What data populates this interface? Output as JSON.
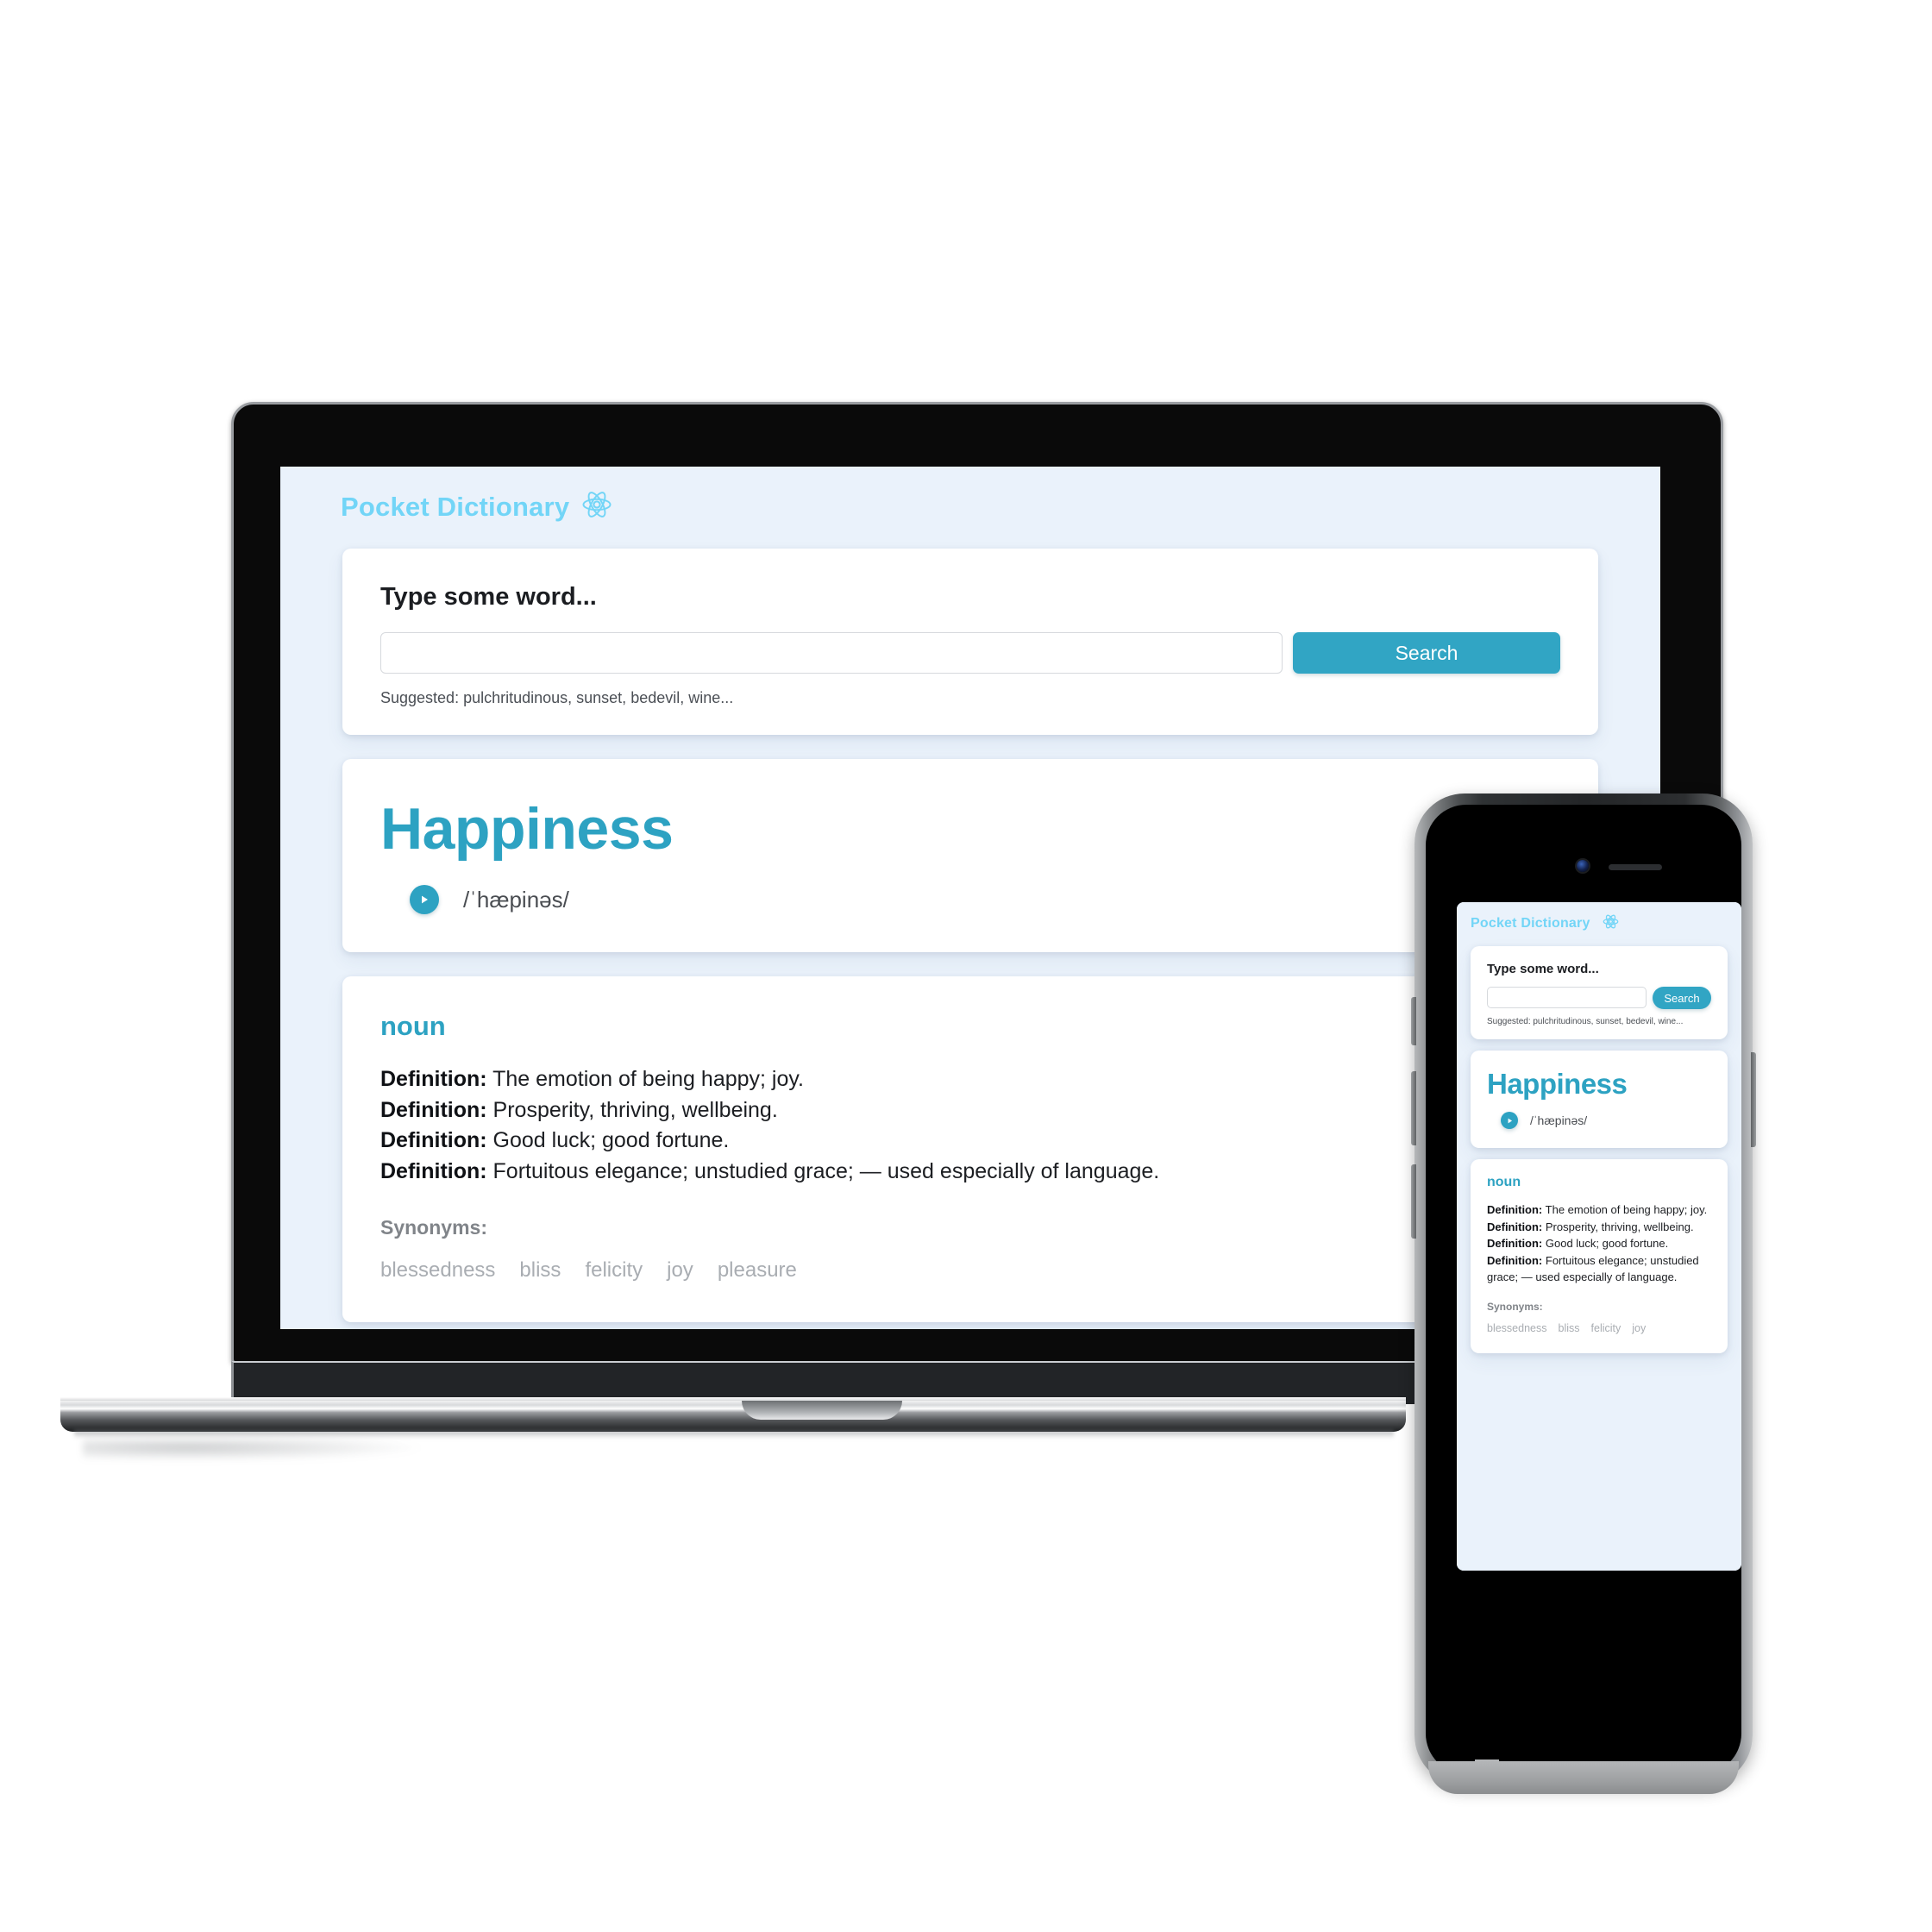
{
  "app": {
    "brand": "Pocket Dictionary",
    "brand_icon": "react-atom-icon",
    "colors": {
      "brand_text": "#72d5f7",
      "accent": "#31a5c4",
      "word_title": "#2da2c2",
      "app_background": "#eaf2fb",
      "card_background": "#ffffff",
      "synonym_text": "#a9adb2"
    }
  },
  "search": {
    "heading": "Type some word...",
    "input_value": "",
    "input_placeholder": "",
    "button_label": "Search",
    "suggested": "Suggested: pulchritudinous, sunset, bedevil, wine..."
  },
  "word": {
    "title": "Happiness",
    "phonetic": "/ˈhæpinəs/",
    "play_icon": "play-circle-icon"
  },
  "definitions": {
    "part_of_speech": "noun",
    "label": "Definition:",
    "items": [
      "The emotion of being happy; joy.",
      "Prosperity, thriving, wellbeing.",
      "Good luck; good fortune.",
      "Fortuitous elegance; unstudied grace; — used especially of language."
    ],
    "synonyms_label": "Synonyms:",
    "synonyms": [
      "blessedness",
      "bliss",
      "felicity",
      "joy",
      "pleasure"
    ],
    "synonyms_mobile": [
      "blessedness",
      "bliss",
      "felicity",
      "joy"
    ]
  }
}
